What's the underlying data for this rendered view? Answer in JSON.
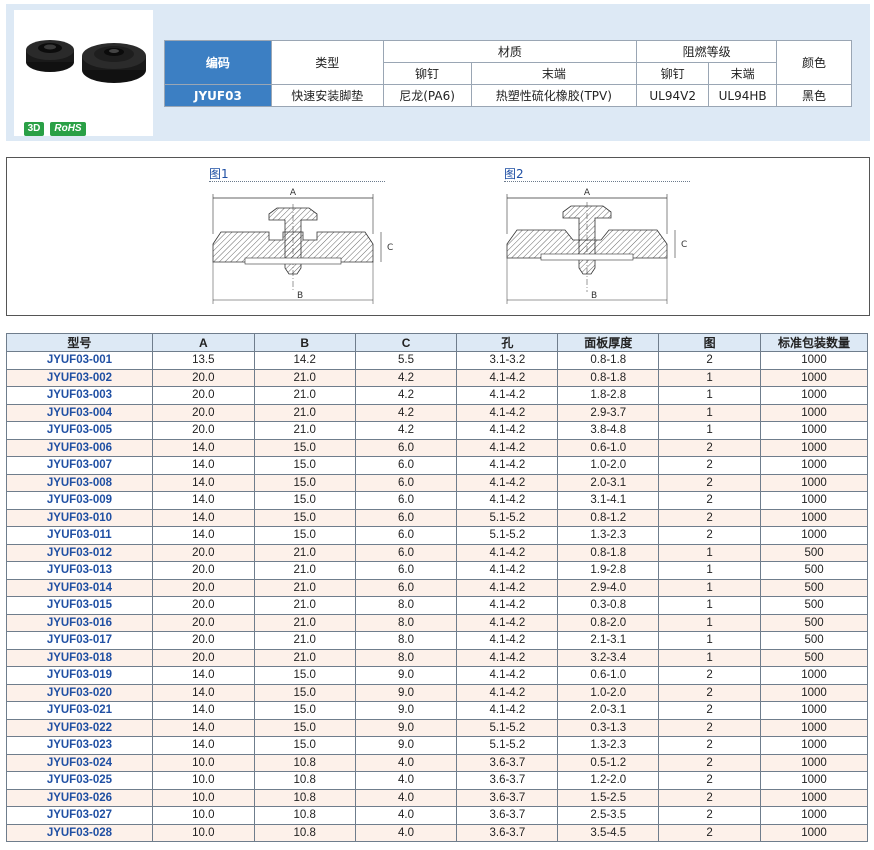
{
  "product": {
    "badges": [
      "3D",
      "RoHS"
    ]
  },
  "spec": {
    "headers": {
      "code": "编码",
      "type": "类型",
      "material": "材质",
      "rivet": "铆钉",
      "end": "末端",
      "flame": "阻燃等级",
      "flame_rivet": "铆钉",
      "flame_end": "末端",
      "color": "颜色"
    },
    "values": {
      "code": "JYUF03",
      "type": "快速安装脚垫",
      "rivet_material": "尼龙(PA6)",
      "end_material": "热塑性硫化橡胶(TPV)",
      "rivet_flame": "UL94V2",
      "end_flame": "UL94HB",
      "color": "黑色"
    }
  },
  "figures": {
    "fig1": {
      "label": "图1",
      "dims": [
        "A",
        "B",
        "C"
      ]
    },
    "fig2": {
      "label": "图2",
      "dims": [
        "A",
        "B",
        "C"
      ]
    }
  },
  "table": {
    "headers": [
      "型号",
      "A",
      "B",
      "C",
      "孔",
      "面板厚度",
      "图",
      "标准包装数量"
    ],
    "rows": [
      [
        "JYUF03-001",
        "13.5",
        "14.2",
        "5.5",
        "3.1-3.2",
        "0.8-1.8",
        "2",
        "1000"
      ],
      [
        "JYUF03-002",
        "20.0",
        "21.0",
        "4.2",
        "4.1-4.2",
        "0.8-1.8",
        "1",
        "1000"
      ],
      [
        "JYUF03-003",
        "20.0",
        "21.0",
        "4.2",
        "4.1-4.2",
        "1.8-2.8",
        "1",
        "1000"
      ],
      [
        "JYUF03-004",
        "20.0",
        "21.0",
        "4.2",
        "4.1-4.2",
        "2.9-3.7",
        "1",
        "1000"
      ],
      [
        "JYUF03-005",
        "20.0",
        "21.0",
        "4.2",
        "4.1-4.2",
        "3.8-4.8",
        "1",
        "1000"
      ],
      [
        "JYUF03-006",
        "14.0",
        "15.0",
        "6.0",
        "4.1-4.2",
        "0.6-1.0",
        "2",
        "1000"
      ],
      [
        "JYUF03-007",
        "14.0",
        "15.0",
        "6.0",
        "4.1-4.2",
        "1.0-2.0",
        "2",
        "1000"
      ],
      [
        "JYUF03-008",
        "14.0",
        "15.0",
        "6.0",
        "4.1-4.2",
        "2.0-3.1",
        "2",
        "1000"
      ],
      [
        "JYUF03-009",
        "14.0",
        "15.0",
        "6.0",
        "4.1-4.2",
        "3.1-4.1",
        "2",
        "1000"
      ],
      [
        "JYUF03-010",
        "14.0",
        "15.0",
        "6.0",
        "5.1-5.2",
        "0.8-1.2",
        "2",
        "1000"
      ],
      [
        "JYUF03-011",
        "14.0",
        "15.0",
        "6.0",
        "5.1-5.2",
        "1.3-2.3",
        "2",
        "1000"
      ],
      [
        "JYUF03-012",
        "20.0",
        "21.0",
        "6.0",
        "4.1-4.2",
        "0.8-1.8",
        "1",
        "500"
      ],
      [
        "JYUF03-013",
        "20.0",
        "21.0",
        "6.0",
        "4.1-4.2",
        "1.9-2.8",
        "1",
        "500"
      ],
      [
        "JYUF03-014",
        "20.0",
        "21.0",
        "6.0",
        "4.1-4.2",
        "2.9-4.0",
        "1",
        "500"
      ],
      [
        "JYUF03-015",
        "20.0",
        "21.0",
        "8.0",
        "4.1-4.2",
        "0.3-0.8",
        "1",
        "500"
      ],
      [
        "JYUF03-016",
        "20.0",
        "21.0",
        "8.0",
        "4.1-4.2",
        "0.8-2.0",
        "1",
        "500"
      ],
      [
        "JYUF03-017",
        "20.0",
        "21.0",
        "8.0",
        "4.1-4.2",
        "2.1-3.1",
        "1",
        "500"
      ],
      [
        "JYUF03-018",
        "20.0",
        "21.0",
        "8.0",
        "4.1-4.2",
        "3.2-3.4",
        "1",
        "500"
      ],
      [
        "JYUF03-019",
        "14.0",
        "15.0",
        "9.0",
        "4.1-4.2",
        "0.6-1.0",
        "2",
        "1000"
      ],
      [
        "JYUF03-020",
        "14.0",
        "15.0",
        "9.0",
        "4.1-4.2",
        "1.0-2.0",
        "2",
        "1000"
      ],
      [
        "JYUF03-021",
        "14.0",
        "15.0",
        "9.0",
        "4.1-4.2",
        "2.0-3.1",
        "2",
        "1000"
      ],
      [
        "JYUF03-022",
        "14.0",
        "15.0",
        "9.0",
        "5.1-5.2",
        "0.3-1.3",
        "2",
        "1000"
      ],
      [
        "JYUF03-023",
        "14.0",
        "15.0",
        "9.0",
        "5.1-5.2",
        "1.3-2.3",
        "2",
        "1000"
      ],
      [
        "JYUF03-024",
        "10.0",
        "10.8",
        "4.0",
        "3.6-3.7",
        "0.5-1.2",
        "2",
        "1000"
      ],
      [
        "JYUF03-025",
        "10.0",
        "10.8",
        "4.0",
        "3.6-3.7",
        "1.2-2.0",
        "2",
        "1000"
      ],
      [
        "JYUF03-026",
        "10.0",
        "10.8",
        "4.0",
        "3.6-3.7",
        "1.5-2.5",
        "2",
        "1000"
      ],
      [
        "JYUF03-027",
        "10.0",
        "10.8",
        "4.0",
        "3.6-3.7",
        "2.5-3.5",
        "2",
        "1000"
      ],
      [
        "JYUF03-028",
        "10.0",
        "10.8",
        "4.0",
        "3.6-3.7",
        "3.5-4.5",
        "2",
        "1000"
      ]
    ]
  }
}
